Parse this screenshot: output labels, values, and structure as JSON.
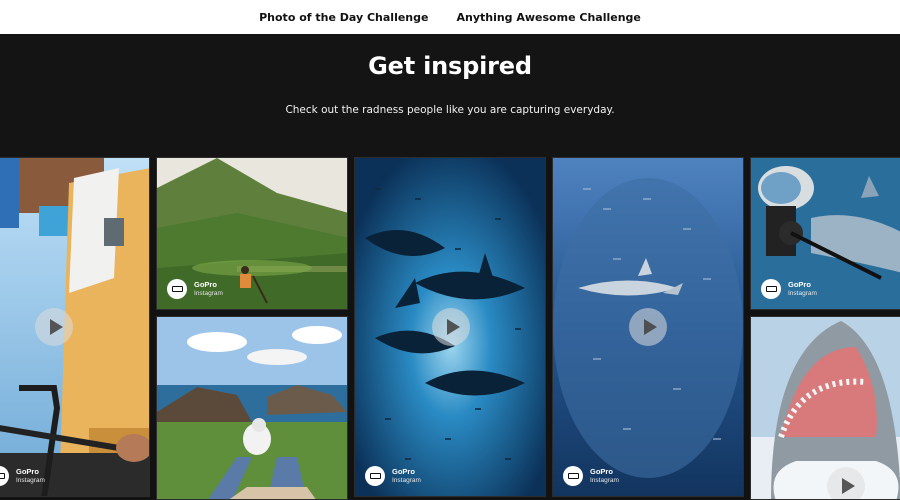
{
  "nav": {
    "items": [
      {
        "label": "Photo of the Day Challenge"
      },
      {
        "label": "Anything Awesome Challenge"
      }
    ]
  },
  "hero": {
    "title": "Get inspired",
    "subtitle": "Check out the radness people like you are capturing everyday."
  },
  "tiles": [
    {
      "id": "bike",
      "type": "video",
      "author": "GoPro",
      "source": "Instagram"
    },
    {
      "id": "hiker",
      "type": "photo",
      "author": "GoPro",
      "source": "Instagram"
    },
    {
      "id": "coast",
      "type": "photo",
      "author": "",
      "source": ""
    },
    {
      "id": "sharks-school",
      "type": "video",
      "author": "GoPro",
      "source": "Instagram"
    },
    {
      "id": "fish-ball",
      "type": "video",
      "author": "GoPro",
      "source": "Instagram"
    },
    {
      "id": "diver-shark",
      "type": "photo",
      "author": "GoPro",
      "source": "Instagram"
    },
    {
      "id": "great-white",
      "type": "video",
      "author": "",
      "source": ""
    }
  ],
  "colors": {
    "nav_bg": "#ffffff",
    "page_bg": "#141414",
    "text_light": "#ffffff"
  }
}
